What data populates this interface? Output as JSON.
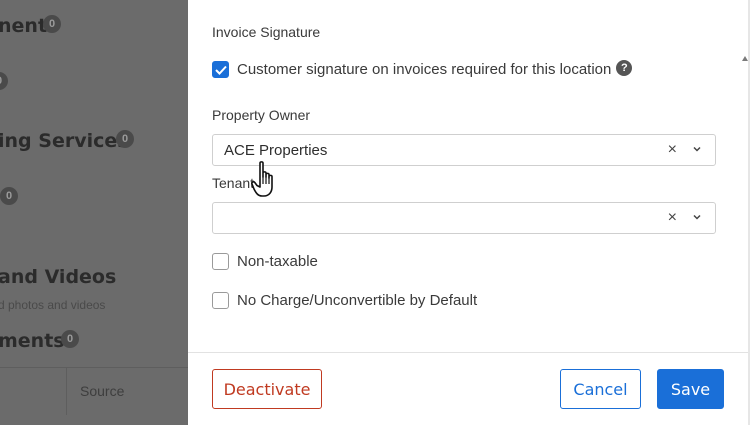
{
  "background": {
    "headings": [
      {
        "text": "nent",
        "badge": "0"
      },
      {
        "text": "",
        "badge": "0"
      },
      {
        "text": "ing Services",
        "badge": "0"
      },
      {
        "text": "",
        "badge": "0"
      },
      {
        "text": " and Videos"
      },
      {
        "text": "ments",
        "badge": "0"
      }
    ],
    "subtext": "d photos and videos",
    "table_header_label": "Source"
  },
  "modal": {
    "invoice_signature": {
      "label": "Invoice Signature",
      "checkbox_label": "Customer signature on invoices required for this location",
      "checked": true,
      "help_icon": "?"
    },
    "property_owner": {
      "label": "Property Owner",
      "value": "ACE Properties",
      "clear": "×"
    },
    "tenant": {
      "label": "Tenant",
      "value": "",
      "clear": "×"
    },
    "non_taxable": {
      "label": "Non-taxable",
      "checked": false
    },
    "no_charge": {
      "label": "No Charge/Unconvertible by Default",
      "checked": false
    }
  },
  "footer": {
    "deactivate_label": "Deactivate",
    "cancel_label": "Cancel",
    "save_label": "Save"
  },
  "colors": {
    "primary": "#1a6fd8",
    "danger": "#c03a21",
    "overlay": "#6b6b6b"
  }
}
